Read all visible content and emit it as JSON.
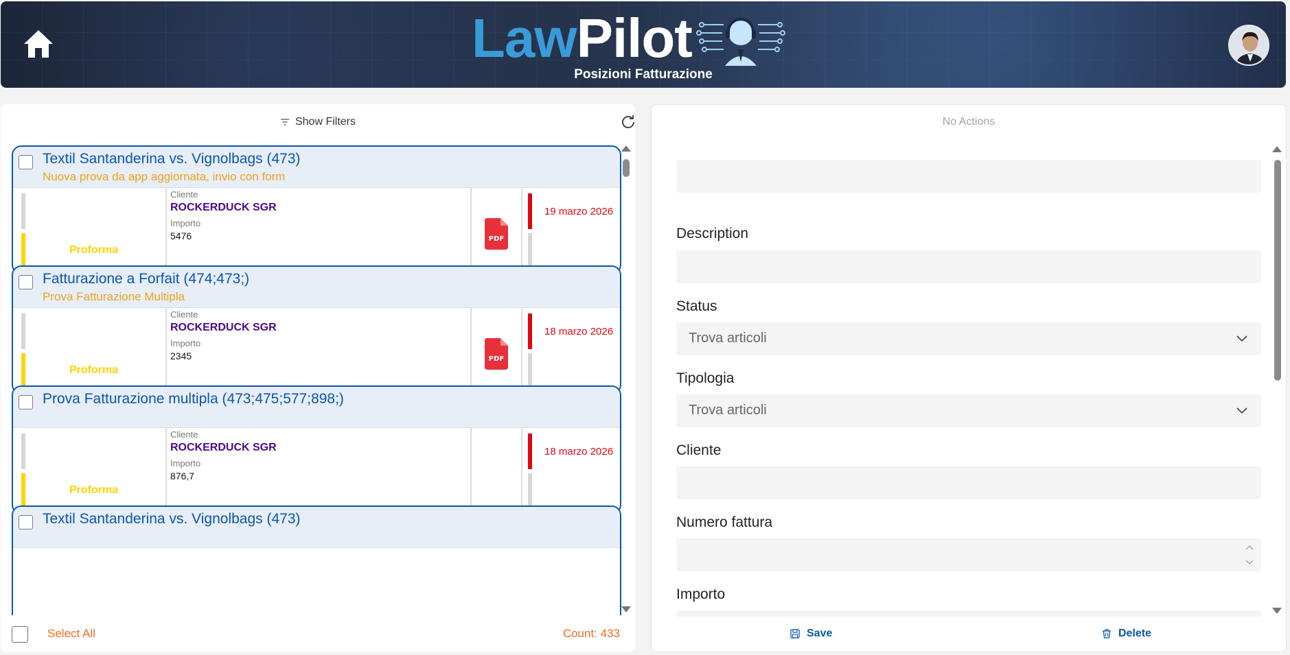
{
  "header": {
    "logo_part1": "Law",
    "logo_part2": "Pilot",
    "subtitle": "Posizioni Fatturazione",
    "home_icon": "home-icon",
    "avatar": "user-avatar"
  },
  "toolbar": {
    "show_filters_label": "Show Filters",
    "filter_icon": "filter-icon",
    "refresh_icon": "refresh-icon"
  },
  "list": {
    "items": [
      {
        "title": "Textil Santanderina vs. Vignolbags (473)",
        "subtitle": "Nuova prova da app aggiornata, invio con form",
        "status": "Proforma",
        "cliente_label": "Cliente",
        "cliente": "ROCKERDUCK SGR",
        "importo_label": "Importo",
        "importo": "5476",
        "has_pdf": true,
        "pdf_label": "PDF",
        "date": "19 marzo 2026"
      },
      {
        "title": "Fatturazione a Forfait (474;473;)",
        "subtitle": "Prova Fatturazione Multipla",
        "status": "Proforma",
        "cliente_label": "Cliente",
        "cliente": "ROCKERDUCK SGR",
        "importo_label": "Importo",
        "importo": "2345",
        "has_pdf": true,
        "pdf_label": "PDF",
        "date": "18 marzo 2026"
      },
      {
        "title": "Prova Fatturazione multipla (473;475;577;898;)",
        "subtitle": "",
        "status": "Proforma",
        "cliente_label": "Cliente",
        "cliente": "ROCKERDUCK SGR",
        "importo_label": "Importo",
        "importo": "876,7",
        "has_pdf": false,
        "pdf_label": "",
        "date": "18 marzo 2026"
      },
      {
        "title": "Textil Santanderina vs. Vignolbags (473)",
        "subtitle": "",
        "status": "",
        "cliente_label": "",
        "cliente": "",
        "importo_label": "",
        "importo": "",
        "has_pdf": false,
        "pdf_label": "",
        "date": ""
      }
    ],
    "select_all_label": "Select All",
    "count_label": "Count: 433"
  },
  "detail": {
    "no_actions_label": "No Actions",
    "fields": {
      "description_label": "Description",
      "status_label": "Status",
      "status_placeholder": "Trova articoli",
      "tipologia_label": "Tipologia",
      "tipologia_placeholder": "Trova articoli",
      "cliente_label": "Cliente",
      "numero_fattura_label": "Numero fattura",
      "importo_label": "Importo"
    },
    "save_label": "Save",
    "delete_label": "Delete",
    "save_icon": "save-icon",
    "delete_icon": "trash-icon"
  },
  "colors": {
    "brand_blue": "#0b56a8",
    "logo_blue": "#3a9bd9",
    "status_yellow": "#ffd200",
    "date_red": "#e10613",
    "cliente_purple": "#4a0a8a",
    "accent_orange": "#f06d1f",
    "subtitle_orange": "#f0a318"
  }
}
